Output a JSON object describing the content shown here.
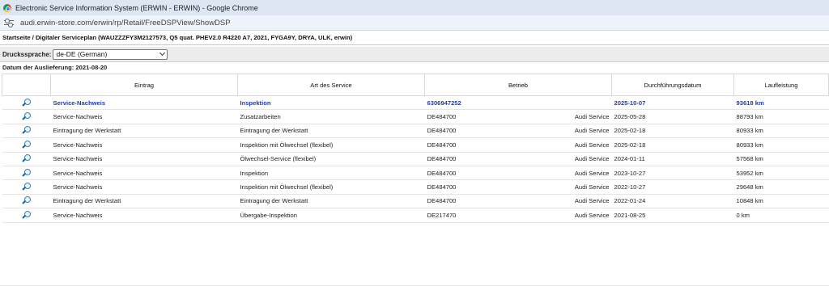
{
  "window": {
    "title": "Electronic Service Information System (ERWIN - ERWIN) - Google Chrome"
  },
  "address": {
    "url": "audi.erwin-store.com/erwin/rp/Retail/FreeDSPView/ShowDSP"
  },
  "breadcrumb": "Startseite / Digitaler Serviceplan (WAUZZZFY3M2127573, Q5 quat. PHEV2.0 R4220 A7, 2021, FYGA9Y, DRYA, ULK, erwin)",
  "language": {
    "label": "Druckssprache:",
    "selected": "de-DE (German)"
  },
  "delivery": "Datum der Auslieferung: 2021-08-20",
  "table": {
    "headers": [
      "",
      "Eintrag",
      "Art des Service",
      "Betrieb",
      "Durchführungsdatum",
      "Laufleistung"
    ],
    "rows": [
      {
        "entry": "Service-Nachweis",
        "type": "Inspektion",
        "code": "6306947252",
        "company": "",
        "date": "2025-10-07",
        "mileage": "93618 km"
      },
      {
        "entry": "Service-Nachweis",
        "type": "Zusatzarbeiten",
        "code": "DE484700",
        "company": "Audi Service",
        "date": "2025-05-28",
        "mileage": "88793 km"
      },
      {
        "entry": "Eintragung der Werkstatt",
        "type": "Eintragung der Werkstatt",
        "code": "DE484700",
        "company": "Audi Service",
        "date": "2025-02-18",
        "mileage": "80933 km"
      },
      {
        "entry": "Service-Nachweis",
        "type": "Inspektion mit Ölwechsel (flexibel)",
        "code": "DE484700",
        "company": "Audi Service",
        "date": "2025-02-18",
        "mileage": "80933 km"
      },
      {
        "entry": "Service-Nachweis",
        "type": "Ölwechsel-Service (flexibel)",
        "code": "DE484700",
        "company": "Audi Service",
        "date": "2024-01-11",
        "mileage": "57568 km"
      },
      {
        "entry": "Service-Nachweis",
        "type": "Inspektion",
        "code": "DE484700",
        "company": "Audi Service",
        "date": "2023-10-27",
        "mileage": "53952 km"
      },
      {
        "entry": "Service-Nachweis",
        "type": "Inspektion mit Ölwechsel (flexibel)",
        "code": "DE484700",
        "company": "Audi Service",
        "date": "2022-10-27",
        "mileage": "29648 km"
      },
      {
        "entry": "Eintragung der Werkstatt",
        "type": "Eintragung der Werkstatt",
        "code": "DE484700",
        "company": "Audi Service",
        "date": "2022-01-24",
        "mileage": "10848 km"
      },
      {
        "entry": "Service-Nachweis",
        "type": "Übergabe-Inspektion",
        "code": "DE217470",
        "company": "Audi Service",
        "date": "2021-08-25",
        "mileage": "0 km"
      }
    ]
  },
  "colors": {
    "highlight": "#1a3cb5",
    "icon": "#2c86b8",
    "titlebar": "#dfe6f3"
  },
  "icons": {
    "row_icon": "magnifier-icon",
    "address_icon": "site-settings-icon"
  }
}
